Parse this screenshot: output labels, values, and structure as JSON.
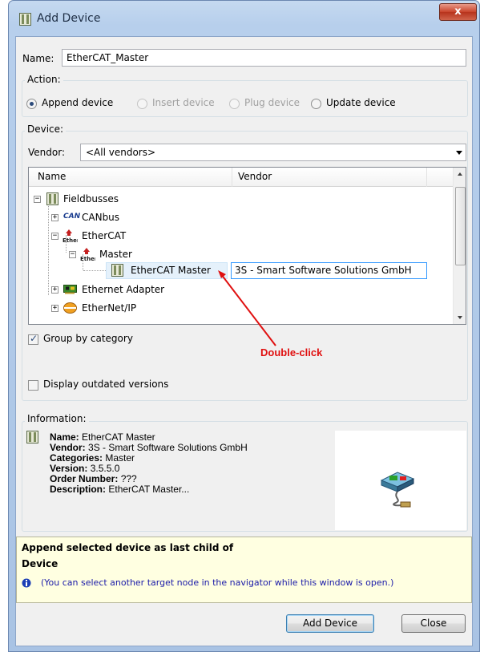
{
  "window": {
    "title": "Add Device",
    "close_label": "x"
  },
  "name_field": {
    "label": "Name:",
    "value": "EtherCAT_Master"
  },
  "action": {
    "label": "Action:",
    "options": [
      {
        "label": "Append device",
        "checked": true,
        "disabled": false
      },
      {
        "label": "Insert device",
        "checked": false,
        "disabled": true
      },
      {
        "label": "Plug device",
        "checked": false,
        "disabled": true
      },
      {
        "label": "Update device",
        "checked": false,
        "disabled": false
      }
    ]
  },
  "device": {
    "label": "Device:",
    "vendor_label": "Vendor:",
    "vendor_value": "<All vendors>",
    "columns": {
      "name": "Name",
      "vendor": "Vendor"
    },
    "tree": {
      "fieldbusses": "Fieldbusses",
      "canbus": "CANbus",
      "can_logo": "CAN",
      "ethercat": "EtherCAT",
      "master": "Master",
      "ethercat_master": "EtherCAT Master",
      "ethercat_master_vendor": "3S - Smart Software Solutions GmbH",
      "ethernet_adapter": "Ethernet Adapter",
      "ethernet_ip": "EtherNet/IP"
    },
    "group_by_category": {
      "label": "Group by category",
      "checked": true
    },
    "display_outdated": {
      "label": "Display outdated versions",
      "checked": false
    },
    "annotation": "Double-click"
  },
  "information": {
    "label": "Information:",
    "name_key": "Name:",
    "name_val": "EtherCAT Master",
    "vendor_key": "Vendor:",
    "vendor_val": "3S - Smart Software Solutions GmbH",
    "categories_key": "Categories:",
    "categories_val": "Master",
    "version_key": "Version:",
    "version_val": "3.5.5.0",
    "order_key": "Order Number:",
    "order_val": "???",
    "description_key": "Description:",
    "description_val": "EtherCAT Master..."
  },
  "hint": {
    "line1": "Append selected device as last child of",
    "line2": "Device",
    "note": "(You can select another target node in the navigator while this window is open.)"
  },
  "buttons": {
    "add": "Add Device",
    "close": "Close"
  },
  "colors": {
    "annotation": "#e01010",
    "hint_bg": "#ffffe1",
    "hint_text": "#1a1aa8",
    "selection_border": "#3399ff"
  }
}
